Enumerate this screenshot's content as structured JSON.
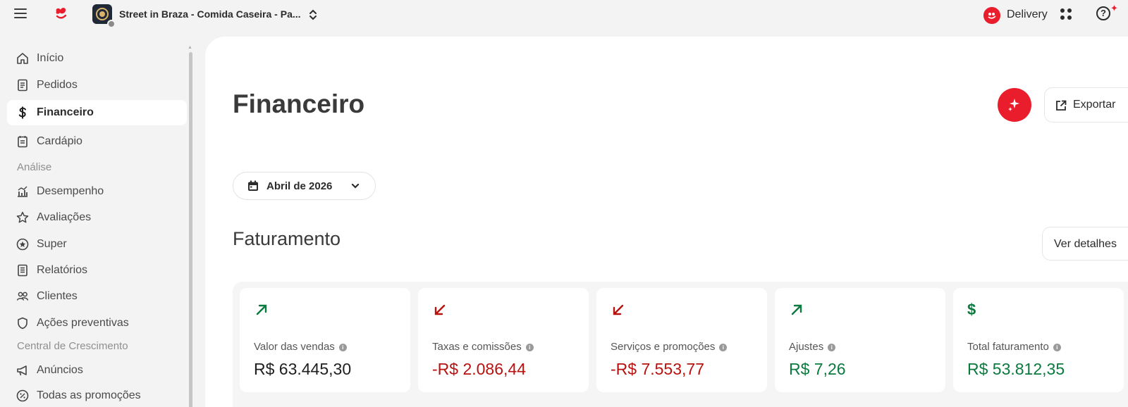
{
  "header": {
    "store_name": "Street in Braza - Comida Caseira - Pa...",
    "delivery_label": "Delivery",
    "help_label": "?",
    "help_badge": "✦"
  },
  "sidebar": {
    "items": [
      {
        "label": "Início",
        "icon": "home-icon"
      },
      {
        "label": "Pedidos",
        "icon": "receipt-icon"
      },
      {
        "label": "Financeiro",
        "icon": "dollar-icon",
        "active": true
      },
      {
        "label": "Cardápio",
        "icon": "menu-book-icon"
      }
    ],
    "section_analysis": "Análise",
    "analysis_items": [
      {
        "label": "Desempenho",
        "icon": "chart-icon"
      },
      {
        "label": "Avaliações",
        "icon": "star-icon"
      },
      {
        "label": "Super",
        "icon": "super-badge-icon"
      },
      {
        "label": "Relatórios",
        "icon": "report-icon"
      },
      {
        "label": "Clientes",
        "icon": "clients-icon"
      },
      {
        "label": "Ações preventivas",
        "icon": "shield-icon"
      }
    ],
    "section_growth": "Central de Crescimento",
    "growth_items": [
      {
        "label": "Anúncios",
        "icon": "megaphone-icon"
      },
      {
        "label": "Todas as promoções",
        "icon": "percent-icon"
      }
    ]
  },
  "main": {
    "title": "Financeiro",
    "export_label": "Exportar",
    "month_label": "Abril de 2026",
    "section_title": "Faturamento",
    "details_label": "Ver detalhes",
    "cards": [
      {
        "label": "Valor das vendas",
        "value": "R$ 63.445,30",
        "trend": "up",
        "tone": "neutral"
      },
      {
        "label": "Taxas e comissões",
        "value": "-R$ 2.086,44",
        "trend": "down",
        "tone": "negative"
      },
      {
        "label": "Serviços e promoções",
        "value": "-R$ 7.553,77",
        "trend": "down",
        "tone": "negative"
      },
      {
        "label": "Ajustes",
        "value": "R$ 7,26",
        "trend": "up",
        "tone": "positive"
      },
      {
        "label": "Total faturamento",
        "value": "R$ 53.812,35",
        "trend": "dollar",
        "tone": "positive"
      }
    ],
    "dollar_symbol": "$",
    "info_symbol": "i"
  },
  "colors": {
    "brand_red": "#ea1d2c",
    "positive_green": "#0b7a3e",
    "negative_red": "#b8120f"
  }
}
